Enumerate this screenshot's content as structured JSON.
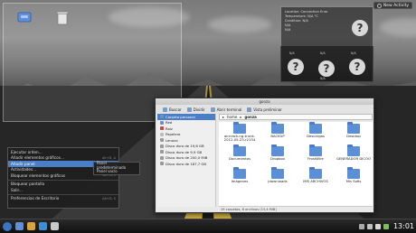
{
  "desktop": {
    "icons": [
      {
        "label": "",
        "icon": "drive-icon"
      },
      {
        "label": "",
        "icon": "trash-icon"
      }
    ],
    "activity_button_label": "New Activity"
  },
  "info_widget": {
    "lines": [
      "Location: Connection Error",
      "Temperature: N/A °C",
      "Condition: N/A",
      "N/A",
      "N/A"
    ],
    "subs": [
      "N/A",
      "N/A",
      "N/A",
      "N/A"
    ]
  },
  "file_manager": {
    "title": "gonza",
    "toolbar": [
      "Buscar",
      "Dividir",
      "Abrir terminal",
      "Vista preliminar"
    ],
    "sidebar": [
      "Carpeta personal",
      "Red",
      "Raíz",
      "Papelera",
      "Lenovo",
      "Disco duro de 19,6 GB",
      "Disco duro de 9,9 GB",
      "Disco duro de 200,0 MiB",
      "Disco duro de 187,7 GB"
    ],
    "path": [
      "home",
      "gonza"
    ],
    "items": [
      "aircrack-ng-trunk-2012-05-23-r2154",
      "BACKUP",
      "Descargas",
      "Desktop",
      "Documentos",
      "Dropbox",
      "FrostWire",
      "GENERADOR DICOO",
      "Imágenes",
      "jdownloads",
      "MIS ARCHIVOS",
      "Mis Sofis"
    ],
    "status": "19 carpetas, 8 archivos (15,4 MiB)"
  },
  "context_menu": {
    "items": [
      {
        "label": "Ejecutar orden...",
        "shortcut": ""
      },
      {
        "label": "Añadir elementos gráficos...",
        "shortcut": "Alt+D, A"
      },
      {
        "label": "Añadir panel",
        "shortcut": ""
      },
      {
        "label": "Actividades...",
        "shortcut": "Alt+D, Alt+A"
      },
      {
        "label": "Bloquear elementos gráficos",
        "shortcut": "Alt+D, L"
      },
      {
        "label": "Bloquear pantalla",
        "shortcut": ""
      },
      {
        "label": "Salir...",
        "shortcut": ""
      },
      {
        "label": "Preferencias de Escritorio",
        "shortcut": "Alt+D, S"
      }
    ],
    "submenu": [
      "Panel predeterminado",
      "Panel vacío"
    ]
  },
  "taskbar": {
    "clock": "13:01"
  },
  "colors": {
    "accent": "#4a7fc7",
    "folder": "#5b8fd6"
  }
}
